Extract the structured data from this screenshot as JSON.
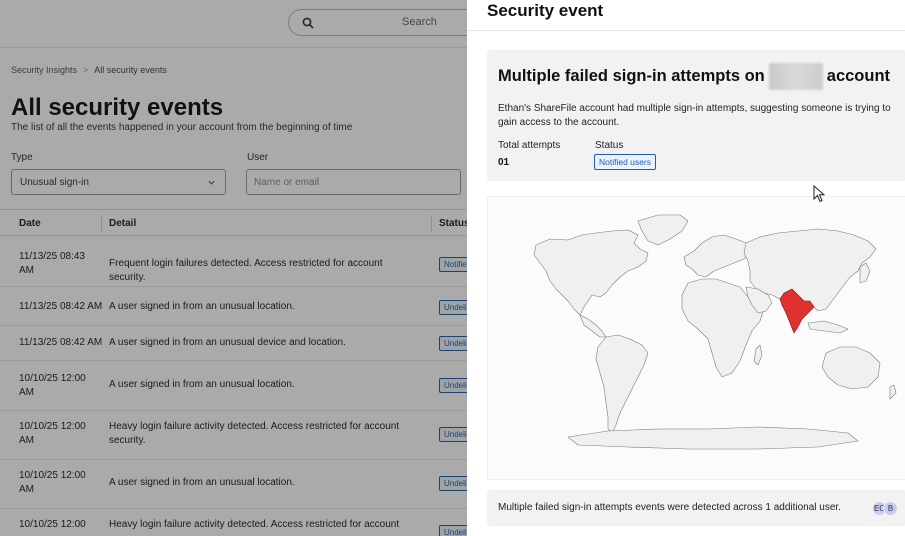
{
  "header": {
    "search_placeholder": "Search"
  },
  "breadcrumb": {
    "items": [
      "Security Insights",
      "All security events"
    ],
    "separator": ">"
  },
  "page": {
    "title": "All security events",
    "subtitle": "The list of all the events happened in your account from the beginning of time"
  },
  "filters": {
    "type_label": "Type",
    "type_value": "Unusual sign-in",
    "user_label": "User",
    "user_placeholder": "Name or email"
  },
  "table": {
    "columns": [
      "Date",
      "Detail",
      "Status"
    ],
    "rows": [
      {
        "date": "11/13/25 08:43 AM",
        "detail": "Frequent login failures detected. Access restricted for account security.",
        "status": "Notifie"
      },
      {
        "date": "11/13/25 08:42 AM",
        "detail": "A user signed in from an unusual location.",
        "status": "Undeli"
      },
      {
        "date": "11/13/25 08:42 AM",
        "detail": "A user signed in from an unusual device and location.",
        "status": "Undeli"
      },
      {
        "date": "10/10/25 12:00 AM",
        "detail": "A user signed in from an unusual location.",
        "status": "Undeli"
      },
      {
        "date": "10/10/25 12:00 AM",
        "detail": "Heavy login failure activity detected. Access restricted for account security.",
        "status": "Undeli"
      },
      {
        "date": "10/10/25 12:00 AM",
        "detail": "A user signed in from an unusual location.",
        "status": "Undeli"
      },
      {
        "date": "10/10/25 12:00",
        "detail": "Heavy login failure activity detected. Access restricted for account",
        "status": "Undeli"
      }
    ]
  },
  "panel": {
    "title": "Security event",
    "event": {
      "heading_prefix": "Multiple failed sign-in attempts on",
      "heading_suffix": "account",
      "description": "Ethan's ShareFile account had multiple sign-in attempts, suggesting someone is trying to gain access to the account.",
      "total_label": "Total attempts",
      "total_value": "01",
      "status_label": "Status",
      "status_value": "Notified users"
    },
    "map": {
      "highlighted_region": "India",
      "highlight_color": "#e03131",
      "land_color": "#f0f0f0",
      "border_color": "#7a7a7a"
    },
    "footer": {
      "text": "Multiple failed sign-in attempts events were detected across 1 additional user.",
      "avatars": [
        "EC",
        "B"
      ]
    }
  },
  "colors": {
    "accent": "#1f5fa8",
    "overlay": "rgba(20,20,20,0.36)"
  }
}
